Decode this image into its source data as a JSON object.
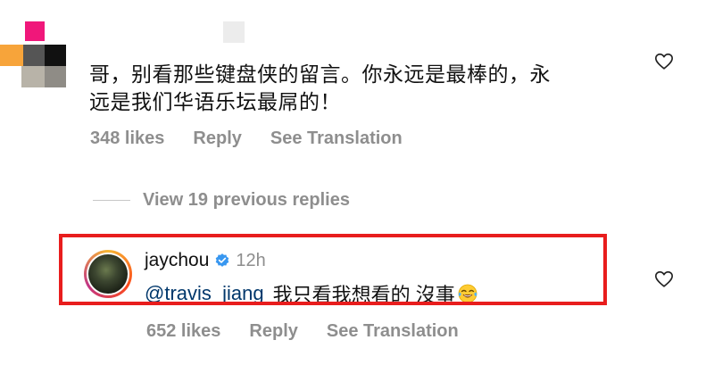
{
  "comment": {
    "text_line1": "哥，别看那些键盘侠的留言。你永远是最棒的，永",
    "text_line2": "远是我们华语乐坛最屌的！",
    "likes": "348 likes",
    "reply_label": "Reply",
    "translation_label": "See Translation"
  },
  "thread": {
    "view_replies_label": "View 19 previous replies"
  },
  "reply": {
    "username": "jaychou",
    "time": "12h",
    "mention": "@travis_jiang",
    "text": "我只看我想看的 沒事",
    "emoji": "face-with-tears-of-joy",
    "likes": "652 likes",
    "reply_label": "Reply",
    "translation_label": "See Translation"
  },
  "colors": {
    "highlight": "#e81d1d",
    "mention": "#00376b",
    "meta": "#8e8e8e",
    "verified": "#3897f0"
  },
  "icons": {
    "like": "heart-outline-icon",
    "verified": "verified-badge-icon"
  }
}
